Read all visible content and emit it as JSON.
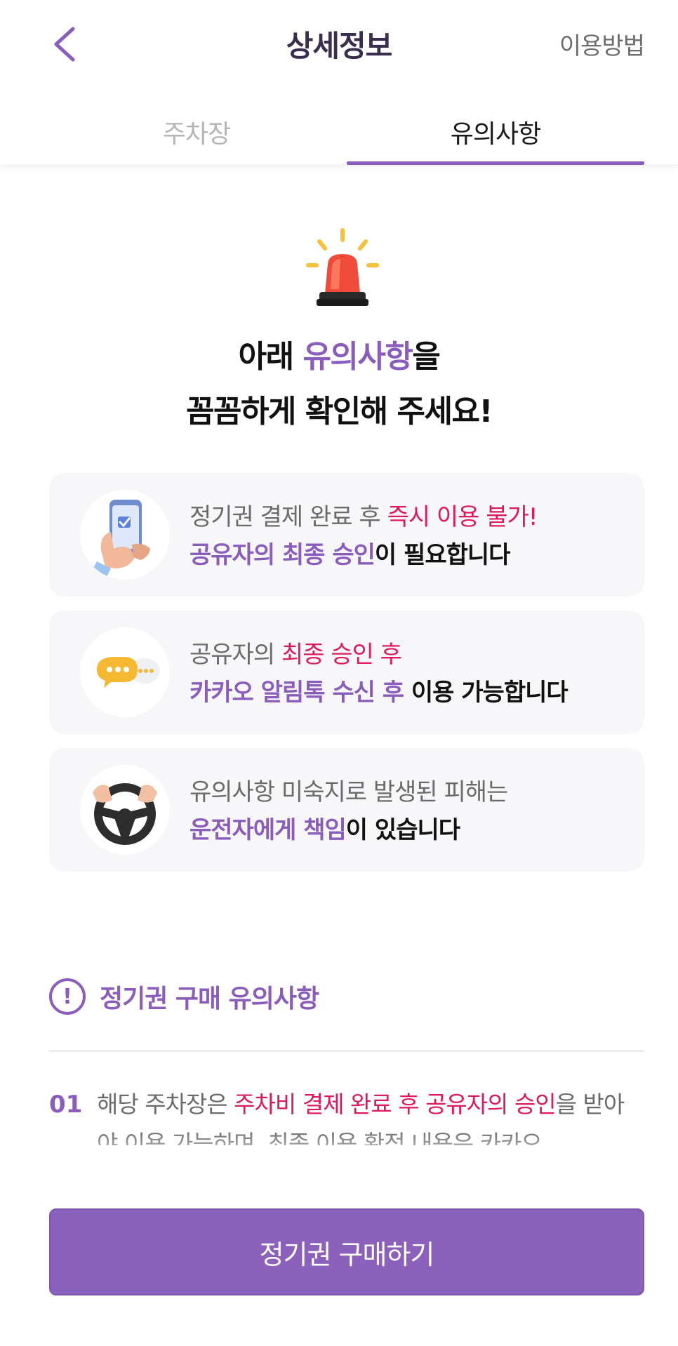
{
  "header": {
    "title": "상세정보",
    "howto_label": "이용방법"
  },
  "tabs": [
    {
      "label": "주차장",
      "active": false
    },
    {
      "label": "유의사항",
      "active": true
    }
  ],
  "headline": {
    "line1_pre": "아래 ",
    "line1_highlight": "유의사항",
    "line1_post": "을",
    "line2": "꼼꼼하게 확인해 주세요!"
  },
  "cards": [
    {
      "icon": "phone-hand-icon",
      "l1_a": "정기권 결제 완료 후 ",
      "l1_b": "즉시 이용 불가!",
      "l2_a": "공유자의 최종 승인",
      "l2_b": "이 필요합니다"
    },
    {
      "icon": "chat-bubble-icon",
      "l1_a": "공유자의 ",
      "l1_b": "최종 승인 후",
      "l2_a": "카카오 알림톡 수신 후",
      "l2_b": " 이용 가능합니다"
    },
    {
      "icon": "steering-wheel-icon",
      "l1_a": "유의사항 미숙지로 발생된 피해는",
      "l1_b": "",
      "l2_a": "운전자에게 책임",
      "l2_b": "이 있습니다"
    }
  ],
  "section": {
    "title": "정기권 구매 유의사항",
    "alert_glyph": "!"
  },
  "notices": [
    {
      "number": "01",
      "pre": "해당 주차장은 ",
      "highlight": "주차비 결제 완료 후 공유자의 승인",
      "post": "을 받아야 이용 가능하며, 최종 이용 확정 내용은 카카오"
    }
  ],
  "cta": {
    "label": "정기권 구매하기"
  },
  "colors": {
    "accent": "#8a5dbd",
    "alert_red": "#e0195c",
    "cta_bg": "#8c61bb",
    "card_bg": "#f7f7f9"
  }
}
